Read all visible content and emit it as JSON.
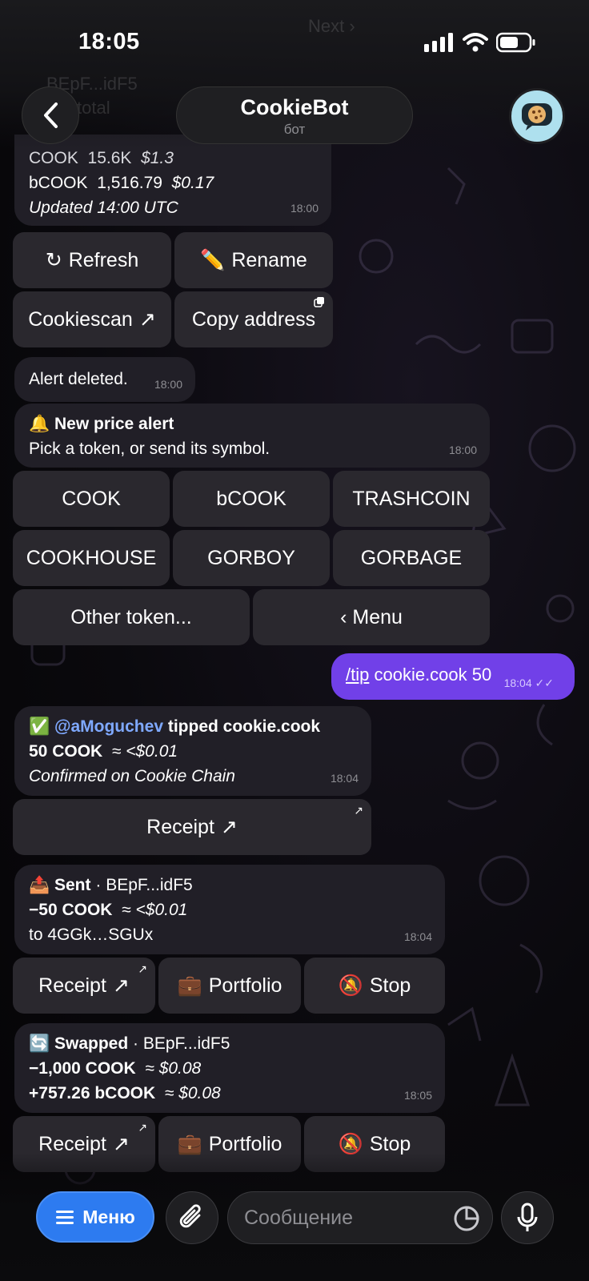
{
  "status_bar": {
    "time": "18:05"
  },
  "header": {
    "title": "CookieBot",
    "subtitle": "бот",
    "ghost_next": "Next ›",
    "ghost_token": "BEpF...idF5",
    "ghost_total": "total"
  },
  "portfolio_tail": {
    "line1_symbol": "COOK",
    "line1_amount": "15.6K",
    "line1_value": "$1.3",
    "line2_symbol": "bCOOK",
    "line2_amount": "1,516.79",
    "line2_value": "$0.17",
    "updated": "Updated 14:00 UTC",
    "time": "18:00",
    "buttons": {
      "refresh": "Refresh",
      "rename": "Rename",
      "cookiescan": "Cookiescan",
      "copy_address": "Copy address"
    }
  },
  "alert_deleted": {
    "text": "Alert deleted.",
    "time": "18:00"
  },
  "new_alert": {
    "title": "New price alert",
    "body": "Pick a token, or send its symbol.",
    "time": "18:00",
    "tokens": [
      "COOK",
      "bCOOK",
      "TRASHCOIN",
      "COOKHOUSE",
      "GORBOY",
      "GORBAGE"
    ],
    "other_token": "Other token...",
    "menu": "‹ Menu"
  },
  "outgoing": {
    "command": "/tip",
    "rest": " cookie.cook 50",
    "time": "18:04"
  },
  "tip": {
    "mention": "@aMoguchev",
    "action": "tipped cookie.cook",
    "amount": "50 COOK",
    "approx": "≈ <$0.01",
    "confirmed": "Confirmed on Cookie Chain",
    "time": "18:04",
    "receipt": "Receipt"
  },
  "sent": {
    "label": "Sent",
    "wallet": "BEpF...idF5",
    "amount": "−50 COOK",
    "approx": "≈ <$0.01",
    "to": "to 4GGk…SGUx",
    "time": "18:04",
    "buttons": {
      "receipt": "Receipt",
      "portfolio": "Portfolio",
      "stop": "Stop"
    }
  },
  "swapped": {
    "label": "Swapped",
    "wallet": "BEpF...idF5",
    "out_amount": "−1,000 COOK",
    "out_approx": "≈ $0.08",
    "in_amount": "+757.26 bCOOK",
    "in_approx": "≈ $0.08",
    "time": "18:05",
    "buttons": {
      "receipt": "Receipt",
      "portfolio": "Portfolio",
      "stop": "Stop"
    }
  },
  "composer": {
    "menu_label": "Меню",
    "placeholder": "Сообщение"
  },
  "colors": {
    "accent_blue": "#2d7bf0",
    "outgoing_purple": "#7140e8",
    "bubble": "#211f27",
    "keyboard_button": "#2a282e",
    "mention": "#7fa9ff"
  }
}
